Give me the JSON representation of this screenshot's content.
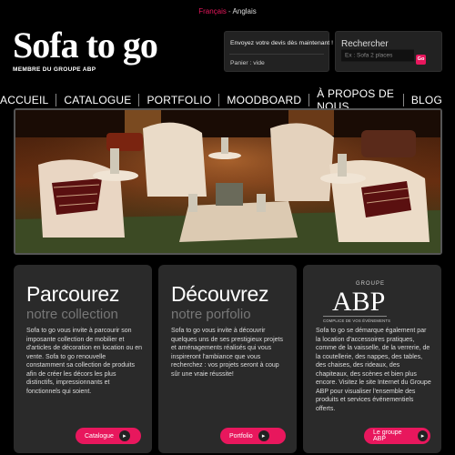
{
  "lang": {
    "active": "Français",
    "separator": "-",
    "other": "Anglais"
  },
  "logo": {
    "title": "Sofa to go",
    "subtitle": "MEMBRE DU GROUPE ABP"
  },
  "cart": {
    "quote_text": "Envoyez votre devis dès maintenant !",
    "panier_text": "Panier : vide"
  },
  "search": {
    "label": "Rechercher",
    "placeholder": "Ex : Sofa 2 places",
    "go_label": "Go"
  },
  "nav": {
    "items": [
      "ACCUEIL",
      "CATALOGUE",
      "PORTFOLIO",
      "MOODBOARD",
      "À PROPOS DE NOUS",
      "BLOG"
    ]
  },
  "cards": [
    {
      "title": "Parcourez",
      "subtitle": "notre collection",
      "body": "Sofa to go vous invite à parcourir son imposante collection de mobilier et d'articles de décoration en location ou en vente. Sofa to go renouvelle constamment sa collection de produits afin de créer les décors les plus distinctifs, impressionnants et fonctionnels qui soient.",
      "button": "Catalogue"
    },
    {
      "title": "Découvrez",
      "subtitle": "notre porfolio",
      "body": "Sofa to go vous invite à découvrir quelques uns de ses prestigieux projets et aménagements réalisés qui vous inspireront l'ambiance que vous recherchez : vos projets seront à coup sûr une vraie réussite!",
      "button": "Portfolio"
    },
    {
      "logo_groupe": "GROUPE",
      "logo_abp": "ABP",
      "logo_tagline": "COMPLICE DE VOS ÉVÉNEMENTS",
      "body": "Sofa to go se démarque également par la location d'accessoires pratiques, comme de la vaisselle, de la verrerie, de la coutellerie, des nappes, des tables, des chaises, des rideaux, des chapiteaux, des scènes et bien plus encore. Visitez le site Internet du Groupe ABP pour visualiser l'ensemble des produits et services événementiels offerts.",
      "button": "Le groupe ABP"
    }
  ],
  "colors": {
    "accent": "#e8175d",
    "card_bg": "#2a2a2a",
    "page_bg": "#000000"
  }
}
